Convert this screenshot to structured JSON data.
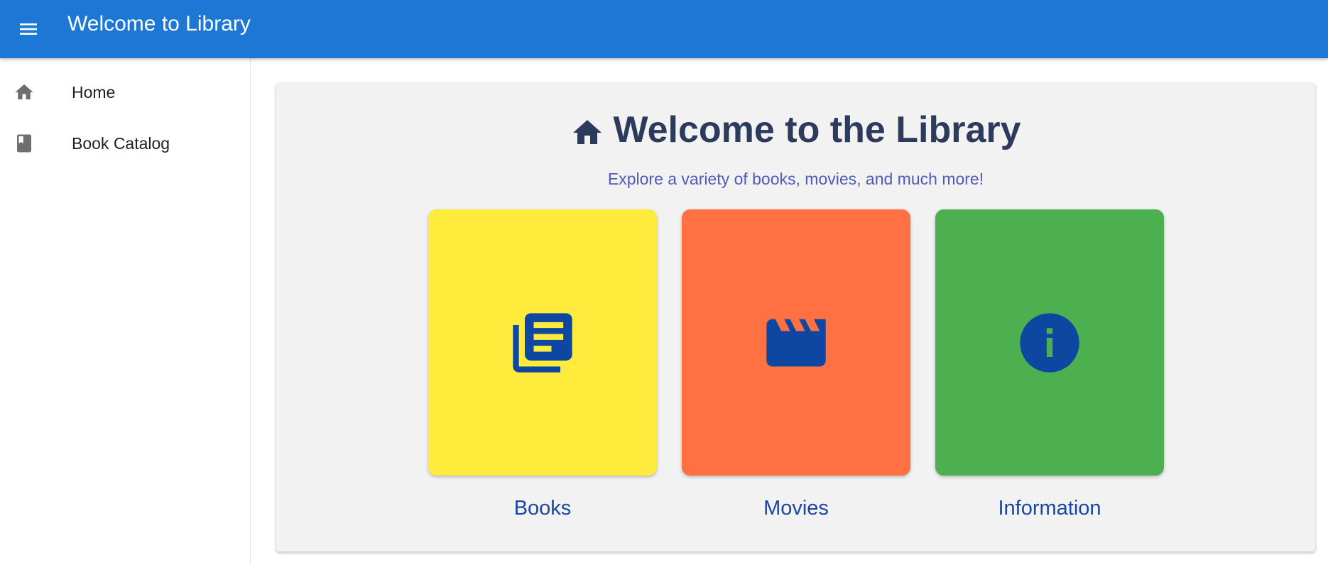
{
  "appbar": {
    "title": "Welcome to Library",
    "menu_icon": "menu-icon",
    "color": "#1c78d4"
  },
  "sidebar": {
    "items": [
      {
        "label": "Home",
        "icon": "home-icon"
      },
      {
        "label": "Book Catalog",
        "icon": "book-icon"
      }
    ]
  },
  "main": {
    "heading": "Welcome to the Library",
    "heading_icon": "home-icon",
    "subtitle": "Explore a variety of books, movies, and much more!",
    "tiles": [
      {
        "label": "Books",
        "icon": "library-books-icon",
        "color": "#ffeb3b"
      },
      {
        "label": "Movies",
        "icon": "movie-clapper-icon",
        "color": "#ff7043"
      },
      {
        "label": "Information",
        "icon": "info-icon",
        "color": "#4caf50"
      }
    ]
  }
}
